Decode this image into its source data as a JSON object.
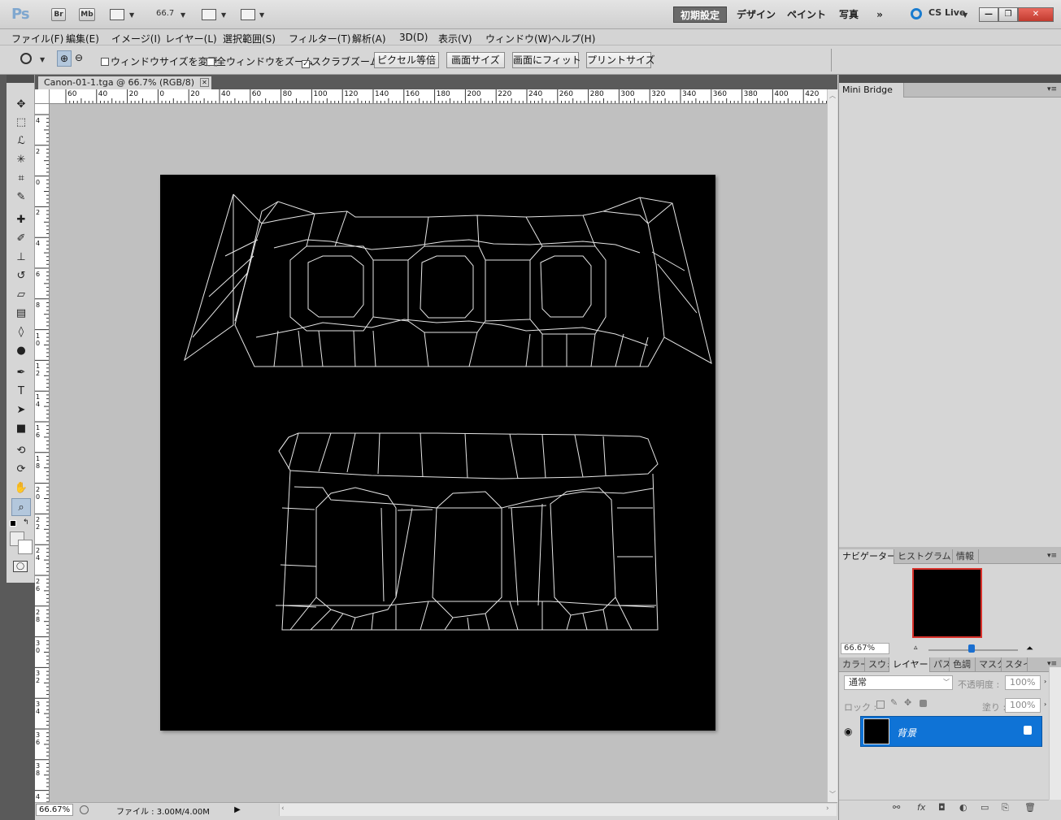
{
  "app": {
    "logo": "Ps",
    "br": "Br",
    "mb": "Mb",
    "zoom": "66.7"
  },
  "workspaces": [
    "初期設定",
    "デザイン",
    "ペイント",
    "写真",
    "»"
  ],
  "cs_live": "CS Live",
  "window_controls": [
    "—",
    "❐",
    "✕"
  ],
  "menu": [
    "ファイル(F)",
    "編集(E)",
    "イメージ(I)",
    "レイヤー(L)",
    "選択範囲(S)",
    "フィルター(T)",
    "解析(A)",
    "3D(D)",
    "表示(V)",
    "ウィンドウ(W)",
    "ヘルプ(H)"
  ],
  "options": {
    "check_resize": "ウィンドウサイズを変更",
    "check_all_windows": "全ウィンドウをズーム",
    "check_scrubby": "スクラブズーム",
    "btn_actual_pixels": "ピクセル等倍",
    "btn_fit_screen": "画面サイズ",
    "btn_fill_screen": "画面にフィット",
    "btn_print_size": "プリントサイズ"
  },
  "document": {
    "tab": "Canon-01-1.tga @ 66.7% (RGB/8)",
    "close": "✕"
  },
  "ruler_top": [
    "60",
    "40",
    "20",
    "0",
    "20",
    "40",
    "60",
    "80",
    "100",
    "120",
    "140",
    "160",
    "180",
    "200",
    "220",
    "240",
    "260",
    "280",
    "300",
    "320",
    "340",
    "360",
    "380",
    "400",
    "420"
  ],
  "ruler_left": [
    "4",
    "2",
    "0",
    "2",
    "4",
    "6",
    "8",
    "10",
    "12",
    "14",
    "16",
    "18",
    "20",
    "22",
    "24",
    "26",
    "28",
    "30",
    "32",
    "34",
    "36",
    "38",
    "4"
  ],
  "status": {
    "zoom": "66.67%",
    "file": "ファイル : 3.00M/4.00M"
  },
  "panels": {
    "mini_bridge": "Mini Bridge",
    "navigator_tabs": [
      "ナビゲーター",
      "ヒストグラム",
      "情報"
    ],
    "navigator_zoom": "66.67%",
    "layer_tabs": [
      "カラー",
      "スウォ",
      "レイヤー",
      "パス",
      "色調",
      "マスク",
      "スタイ"
    ],
    "blend_mode": "通常",
    "opacity_label": "不透明度 :",
    "opacity": "100%",
    "lock_label": "ロック :",
    "fill_label": "塗り :",
    "fill": "100%",
    "layer_name": "背景"
  }
}
